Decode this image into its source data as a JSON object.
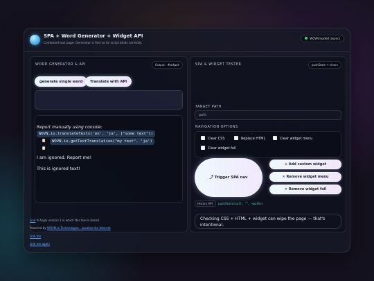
{
  "header": {
    "title": "SPA + Word Generator + Widget API",
    "subtitle": "Combined tool page. Generator is first so its script binds correctly.",
    "status": "WOVN loaded (async)"
  },
  "left": {
    "panel_title": "WORD GENERATOR & API",
    "output_label": "Output:",
    "output_id": "#output",
    "generate_button": "generate single word",
    "translate_button": "Translate with API",
    "report_intro": "Report manually using console:",
    "code_line_1": "WOVN.io.translateTexts('en', 'ja', [\"some text\"])",
    "code_line_2": "WOVN.io.getTextTranslation(\"my text\", 'ja')",
    "ignored_1": "I am ignored. Report me!",
    "ignored_2": "This is ignored text!"
  },
  "right": {
    "panel_title": "SPA & WIDGET TESTER",
    "chip_label": "pushState + clears",
    "target_label": "TARGET PATH",
    "target_placeholder": "path",
    "nav_label": "NAVIGATION OPTIONS",
    "options": [
      "Clear CSS",
      "Replace HTML",
      "Clear widget menu",
      "Clear widget full"
    ],
    "trigger_button": "⤴ Trigger SPA nav",
    "add_button": "+ Add custom widget",
    "remove_menu_button": "✕ Remove widget menu",
    "remove_full_button": "✕ Remove widget full",
    "history_label": "History API:",
    "history_code": "pushState(null, \"\", <path>)",
    "warning": "Checking CSS + HTML + widget can wipe the page — that's intentional."
  },
  "footer": {
    "line1_link": "Link",
    "line1_text": " to fugly version 1 in which this tool is based.",
    "line2_text": "Powered by ",
    "line2_link": "WOVN.io Technologies - Localize the Internet",
    "line3_link": "Link me",
    "line4_link": "Link me again"
  },
  "colors": {
    "status_dot": "#36d57d",
    "link": "#6aa8ff",
    "code_accent": "#5fcfc0"
  }
}
